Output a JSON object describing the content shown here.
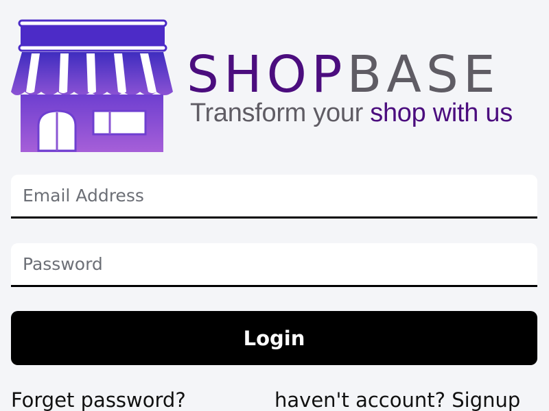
{
  "brand": {
    "name_part1": "SHOP",
    "name_part2": "BASE",
    "tagline_part1": "Transform your ",
    "tagline_part2": "shop with us"
  },
  "form": {
    "email_placeholder": "Email Address",
    "email_value": "",
    "password_placeholder": "Password",
    "password_value": "",
    "login_label": "Login"
  },
  "links": {
    "forget_password": "Forget password?",
    "no_account_text": "haven't account?",
    "signup_label": "Signup"
  },
  "colors": {
    "background": "#f4f5f8",
    "brand_purple": "#4b0d7e",
    "brand_gray": "#5f5c64",
    "button": "#000000",
    "store_awning_top": "#4c2bc7",
    "store_body": "#9b59d6"
  },
  "icons": {
    "logo": "storefront-icon"
  }
}
